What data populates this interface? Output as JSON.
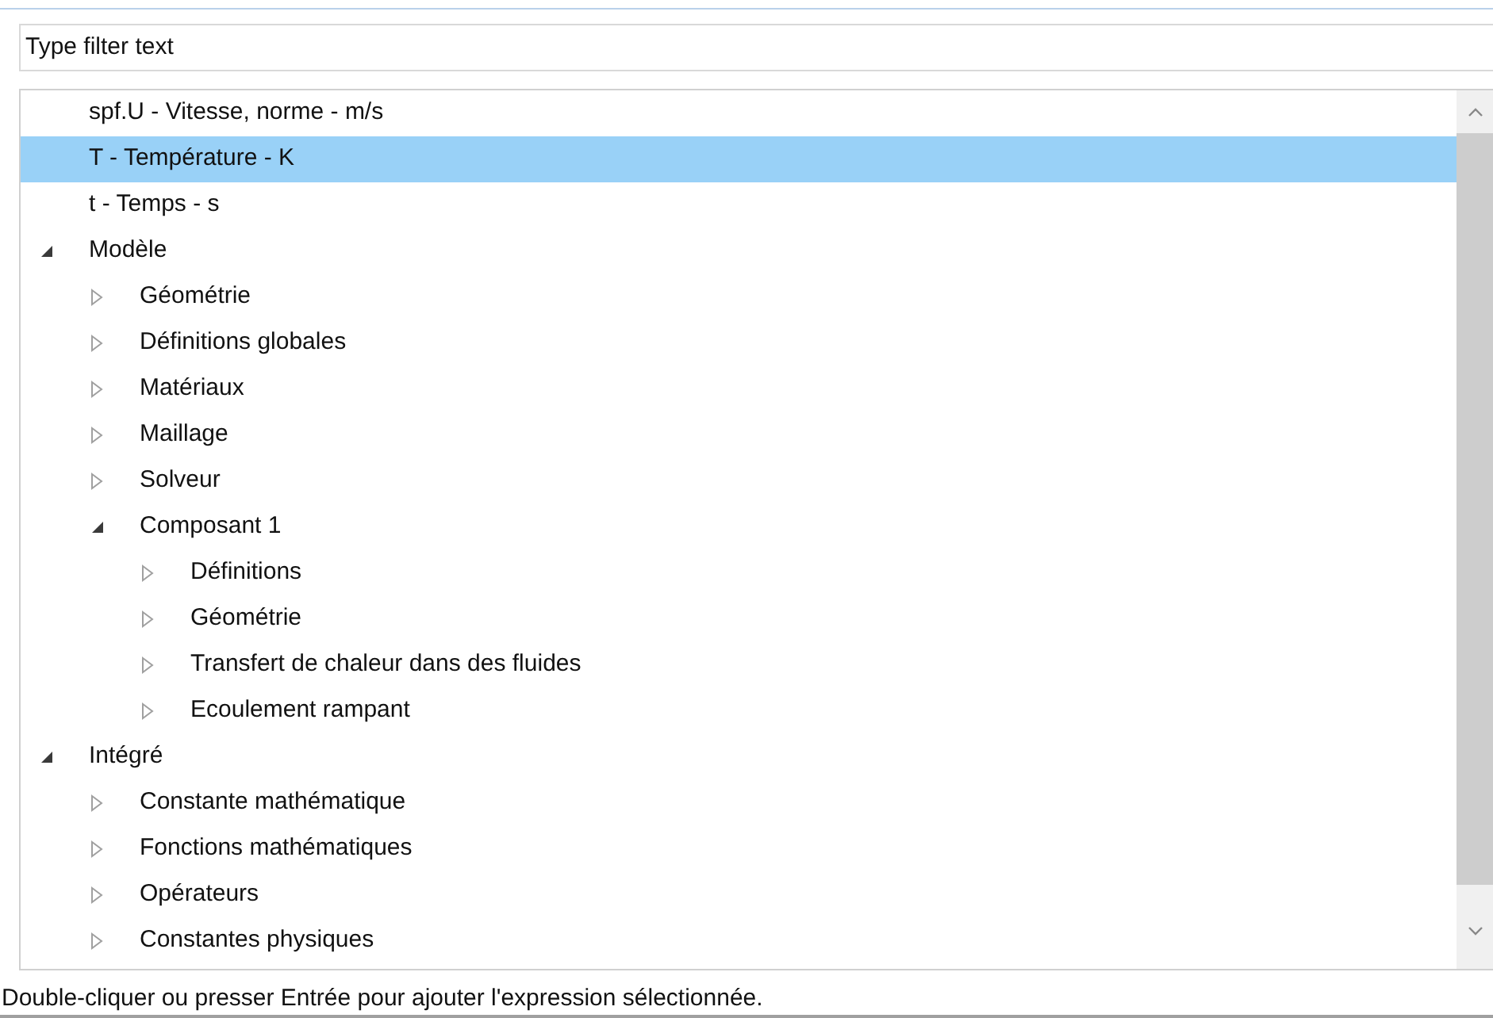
{
  "filter": {
    "placeholder": "Type filter text"
  },
  "tree": [
    {
      "label": "spf.U - Vitesse, norme - m/s",
      "selected": false
    },
    {
      "label": "T - Température - K",
      "selected": true
    },
    {
      "label": "t - Temps - s",
      "selected": false
    },
    {
      "label": "Modèle",
      "selected": false,
      "expanded": true,
      "children": [
        {
          "label": "Géométrie",
          "selected": false,
          "expanded": false
        },
        {
          "label": "Définitions globales",
          "selected": false,
          "expanded": false
        },
        {
          "label": "Matériaux",
          "selected": false,
          "expanded": false
        },
        {
          "label": "Maillage",
          "selected": false,
          "expanded": false
        },
        {
          "label": "Solveur",
          "selected": false,
          "expanded": false
        },
        {
          "label": "Composant 1",
          "selected": false,
          "expanded": true,
          "children": [
            {
              "label": "Définitions",
              "selected": false,
              "expanded": false
            },
            {
              "label": "Géométrie",
              "selected": false,
              "expanded": false
            },
            {
              "label": "Transfert de chaleur dans des fluides",
              "selected": false,
              "expanded": false
            },
            {
              "label": "Ecoulement rampant",
              "selected": false,
              "expanded": false
            }
          ]
        }
      ]
    },
    {
      "label": "Intégré",
      "selected": false,
      "expanded": true,
      "children": [
        {
          "label": "Constante mathématique",
          "selected": false,
          "expanded": false
        },
        {
          "label": "Fonctions mathématiques",
          "selected": false,
          "expanded": false
        },
        {
          "label": "Opérateurs",
          "selected": false,
          "expanded": false
        },
        {
          "label": "Constantes physiques",
          "selected": false,
          "expanded": false
        }
      ]
    }
  ],
  "status": "Double-cliquer ou presser Entrée pour ajouter l'expression sélectionnée."
}
